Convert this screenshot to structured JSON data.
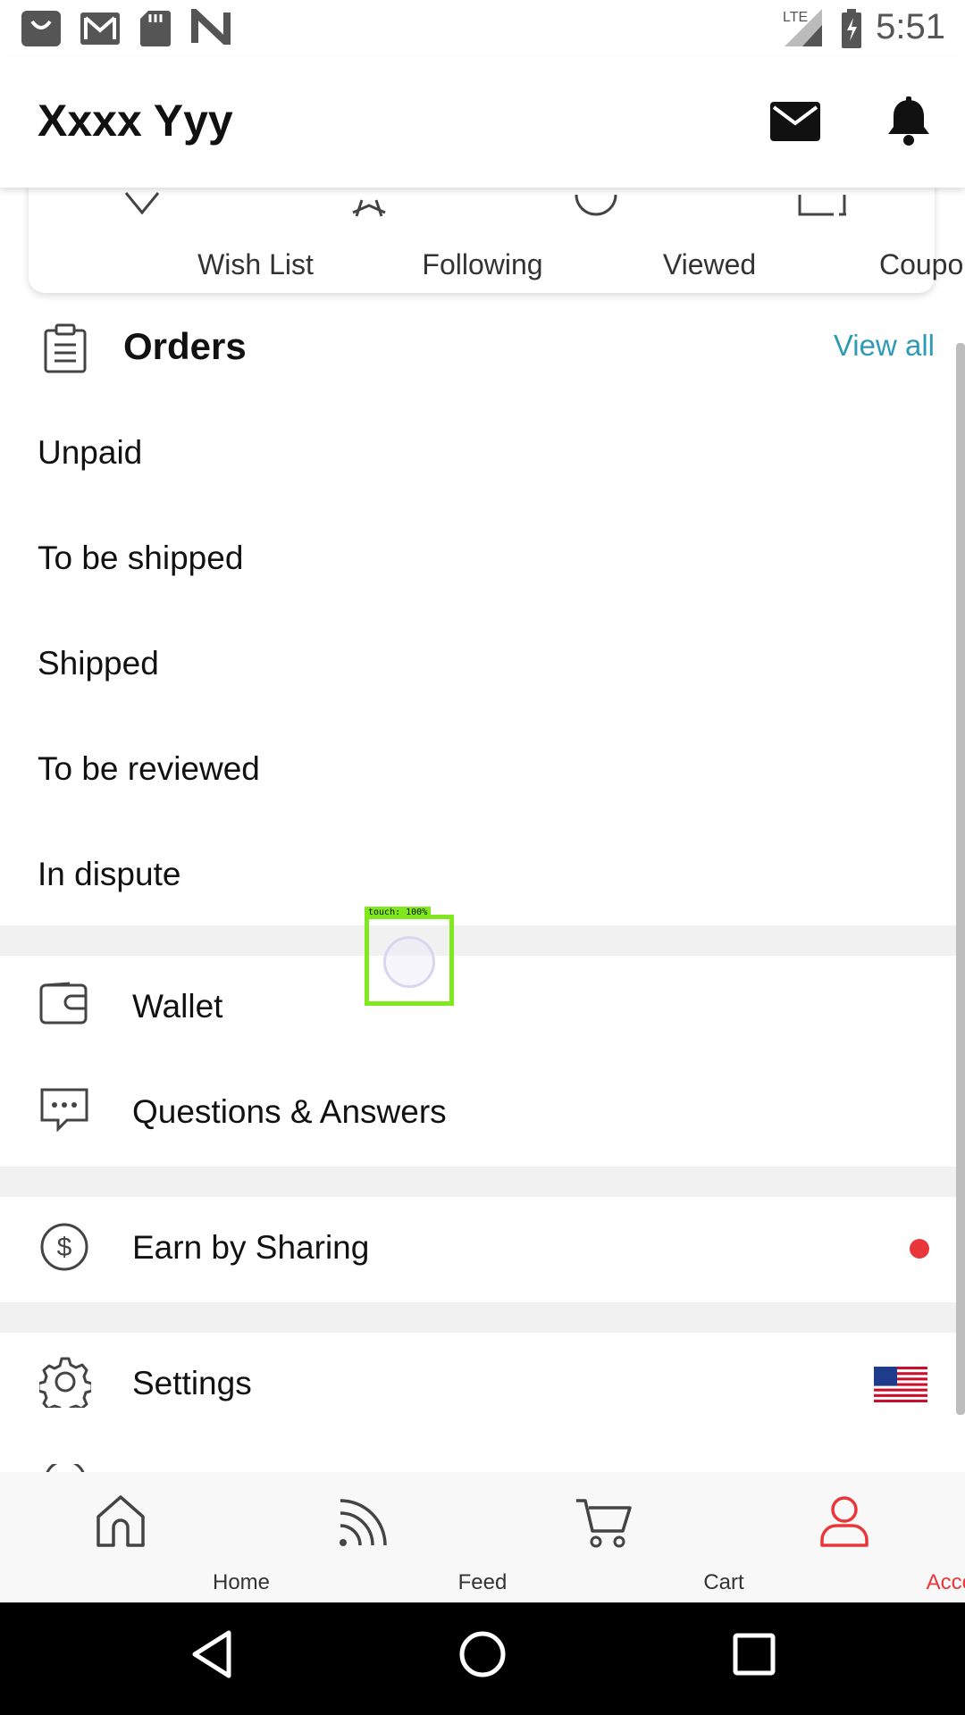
{
  "status_bar": {
    "time": "5:51",
    "network": "LTE",
    "icons": [
      "shopping-bag-icon",
      "gmail-icon",
      "sd-card-icon",
      "n-logo-icon",
      "signal-icon",
      "battery-charging-icon"
    ]
  },
  "header": {
    "username": "Xxxx Yyy",
    "icons": [
      "mail-icon",
      "bell-icon"
    ]
  },
  "quick_links": [
    {
      "label": "Wish List",
      "icon": "heart-icon"
    },
    {
      "label": "Following",
      "icon": "star-icon"
    },
    {
      "label": "Viewed",
      "icon": "clock-icon"
    },
    {
      "label": "Coupons",
      "icon": "coupon-icon"
    }
  ],
  "orders": {
    "title": "Orders",
    "view_all": "View all",
    "rows": [
      "Unpaid",
      "To be shipped",
      "Shipped",
      "To be reviewed",
      "In dispute"
    ]
  },
  "menu": {
    "wallet": "Wallet",
    "qa": "Questions & Answers",
    "earn": "Earn by Sharing",
    "settings": "Settings"
  },
  "colors": {
    "accent_red": "#e8363a",
    "link_blue": "#2e9ab6",
    "touch_green": "#7fe81f"
  },
  "tab_bar": {
    "tabs": [
      {
        "label": "Home",
        "icon": "home-icon",
        "active": false
      },
      {
        "label": "Feed",
        "icon": "feed-icon",
        "active": false
      },
      {
        "label": "Cart",
        "icon": "cart-icon",
        "active": false
      },
      {
        "label": "Account",
        "icon": "account-icon",
        "active": true
      }
    ]
  },
  "touch_overlay": {
    "label": "touch: 100%"
  }
}
